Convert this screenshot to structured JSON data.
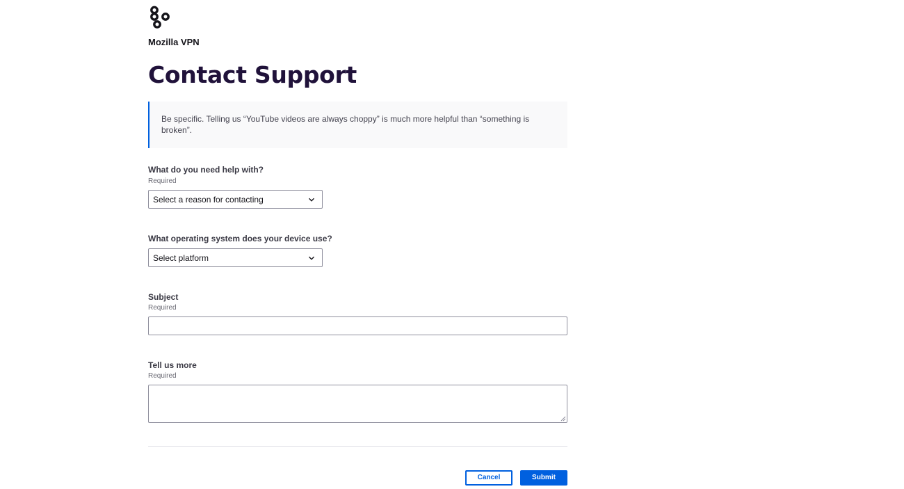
{
  "header": {
    "product_name": "Mozilla VPN",
    "logo_icon": "mozilla-vpn-logo-icon"
  },
  "page": {
    "title": "Contact Support",
    "hint": "Be specific. Telling us “YouTube videos are always choppy” is much more helpful than “something is broken”."
  },
  "form": {
    "reason": {
      "label": "What do you need help with?",
      "required_text": "Required",
      "selected": "Select a reason for contacting"
    },
    "platform": {
      "label": "What operating system does your device use?",
      "selected": "Select platform"
    },
    "subject": {
      "label": "Subject",
      "required_text": "Required",
      "value": ""
    },
    "details": {
      "label": "Tell us more",
      "required_text": "Required",
      "value": ""
    }
  },
  "actions": {
    "cancel_label": "Cancel",
    "submit_label": "Submit"
  },
  "colors": {
    "accent": "#0060df",
    "title": "#20123a",
    "hint_background": "#f9f9fa"
  }
}
